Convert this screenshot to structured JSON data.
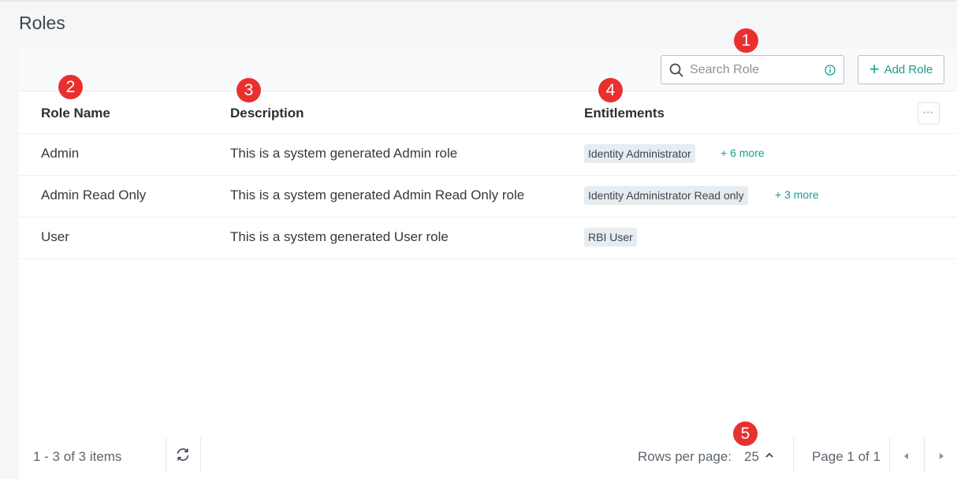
{
  "page": {
    "title": "Roles"
  },
  "toolbar": {
    "search_placeholder": "Search Role",
    "add_role_label": "Add Role"
  },
  "table": {
    "columns": [
      "Role Name",
      "Description",
      "Entitlements"
    ],
    "rows": [
      {
        "name": "Admin",
        "description": "This is a system generated Admin role",
        "entitlement": "Identity Administrator",
        "more": "+ 6 more"
      },
      {
        "name": "Admin Read Only",
        "description": "This is a system generated Admin Read Only role",
        "entitlement": "Identity Administrator Read only",
        "more": "+ 3 more"
      },
      {
        "name": "User",
        "description": "This is a system generated User role",
        "entitlement": "RBI User",
        "more": ""
      }
    ],
    "column_menu": "⋯"
  },
  "footer": {
    "items_count": "1 - 3 of 3 items",
    "rows_per_page_label": "Rows per page:",
    "rows_per_page_value": "25",
    "page_info": "Page 1 of 1"
  },
  "annotations": [
    "1",
    "2",
    "3",
    "4",
    "5"
  ],
  "colors": {
    "accent": "#1a9c8c",
    "badge": "#e8312f",
    "tag_bg": "#e6ecf0"
  }
}
